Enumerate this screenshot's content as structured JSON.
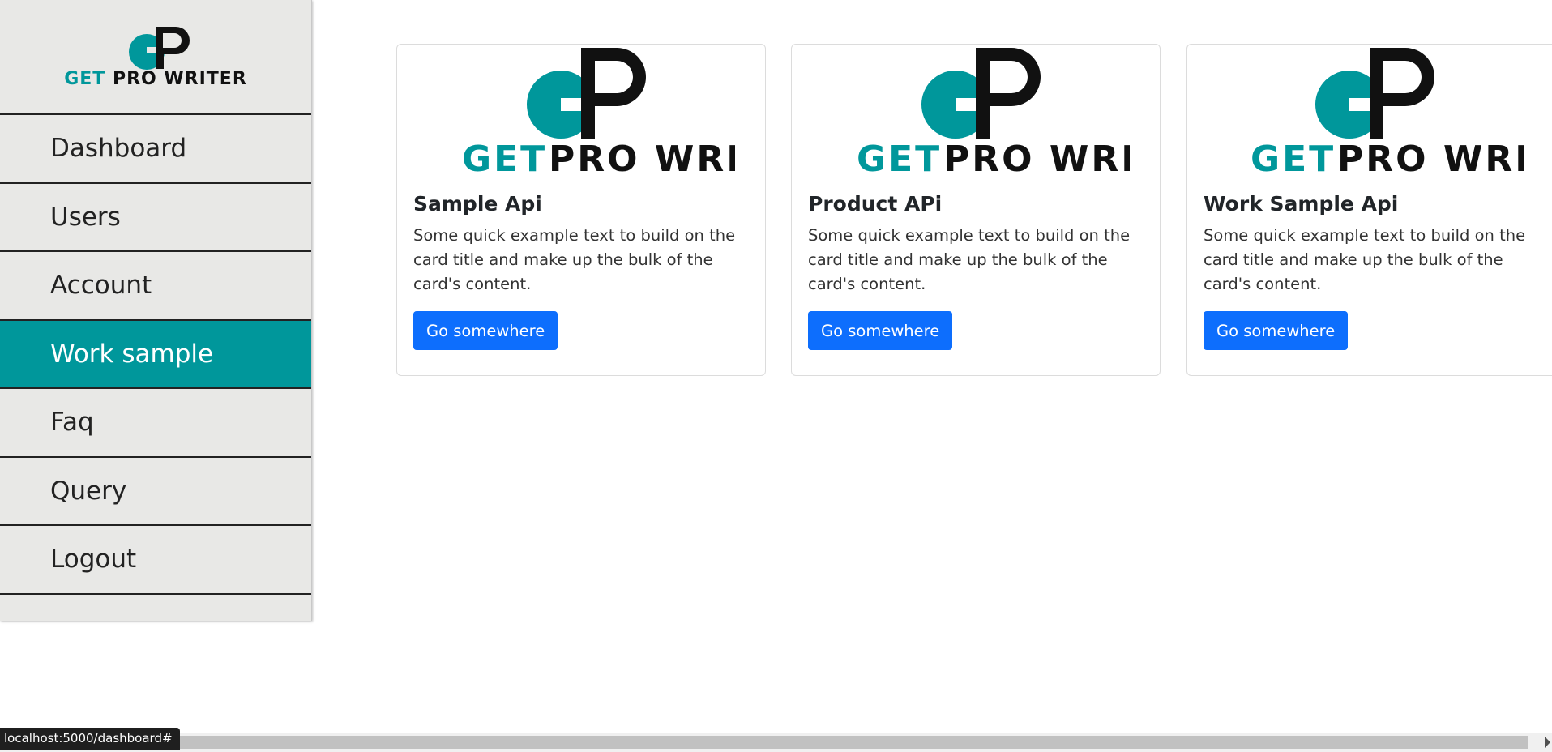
{
  "brand": {
    "logo_letters_g": "G",
    "logo_letters_p": "P",
    "logo_word_get": "GET",
    "logo_word_rest": "PRO WRITER",
    "teal": "#00979b",
    "dark": "#111111"
  },
  "sidebar": {
    "items": [
      {
        "label": "Dashboard",
        "icon": null,
        "active": false
      },
      {
        "label": "Users",
        "active": false
      },
      {
        "label": "Account",
        "active": false
      },
      {
        "label": "Work sample",
        "active": true
      },
      {
        "label": "Faq",
        "active": false
      },
      {
        "label": "Query",
        "active": false
      },
      {
        "label": "Logout",
        "active": false
      }
    ],
    "active_color": "#00979b"
  },
  "cards": [
    {
      "title": "Sample Api",
      "text": "Some quick example text to build on the card title and make up the bulk of the card's content.",
      "button": "Go somewhere"
    },
    {
      "title": "Product APi",
      "text": "Some quick example text to build on the card title and make up the bulk of the card's content.",
      "button": "Go somewhere"
    },
    {
      "title": "Work Sample Api",
      "text": "Some quick example text to build on the card title and make up the bulk of the card's content.",
      "button": "Go somewhere"
    }
  ],
  "button_color": "#0d6efd",
  "status": {
    "url": "localhost:5000/dashboard#"
  }
}
